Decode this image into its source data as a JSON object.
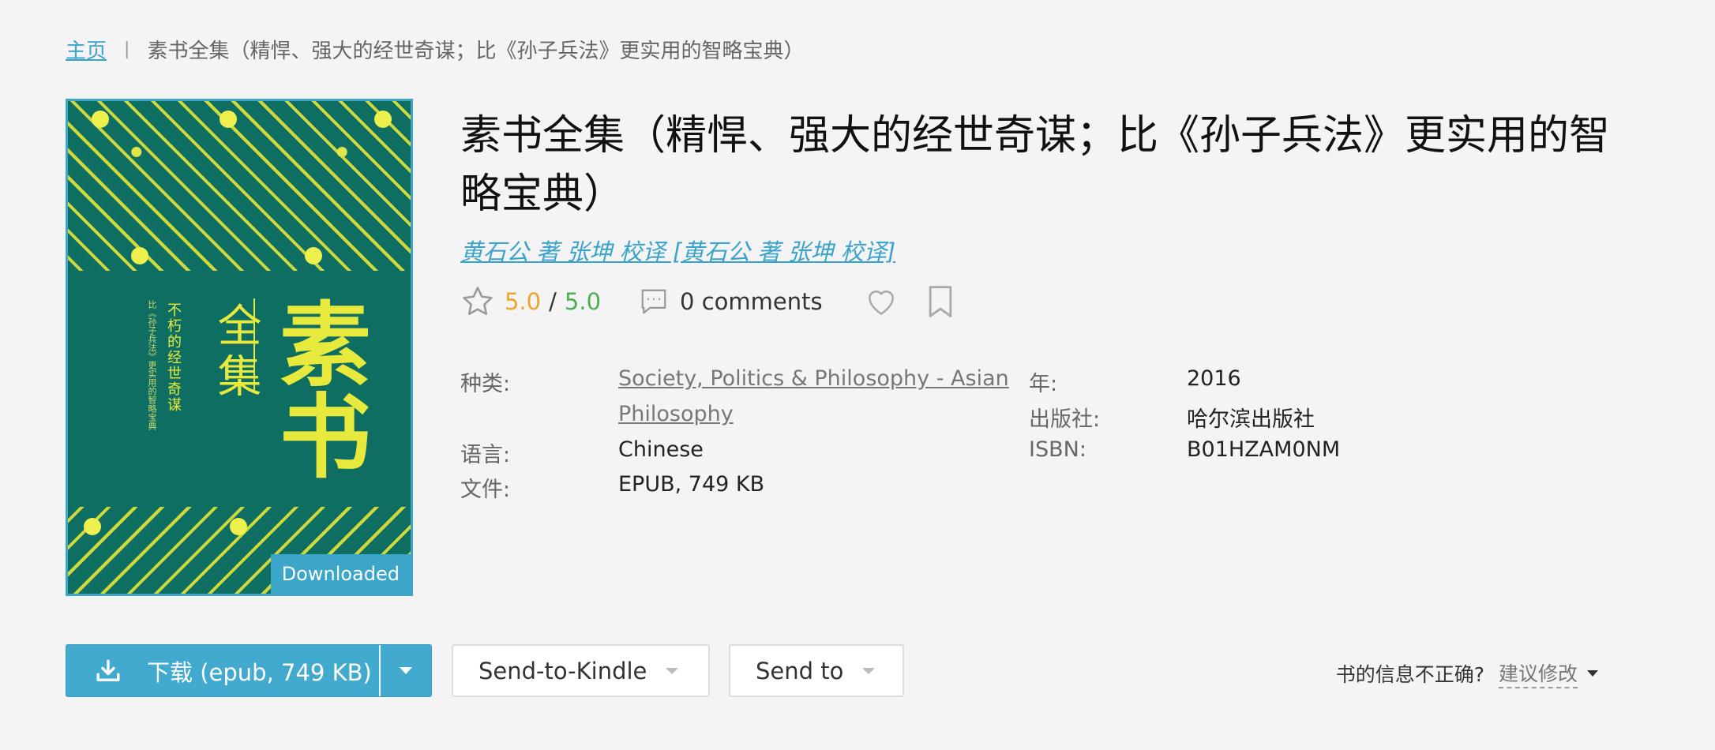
{
  "breadcrumb": {
    "home": "主页",
    "separator": "|",
    "current": "素书全集（精悍、强大的经世奇谋；比《孙子兵法》更实用的智略宝典）"
  },
  "cover": {
    "badge": "Downloaded",
    "title_big": "素书",
    "title_small": "全集",
    "tagline": "不朽的经世奇谋",
    "subline": "比《孙子兵法》更实用的智略宝典",
    "colors": {
      "background": "#0f6e62",
      "ornament": "#e7ea3c",
      "border": "#3ba6c9"
    }
  },
  "book": {
    "title": "素书全集（精悍、强大的经世奇谋；比《孙子兵法》更实用的智略宝典）",
    "authors": "黄石公 著 张坤 校译 [黄石公 著 张坤 校译]"
  },
  "rating": {
    "icon": "star-outline-icon",
    "score_a": "5.0",
    "slash": "/",
    "score_b": "5.0",
    "comments": "0 comments",
    "colors": {
      "score_a": "#f0a22e",
      "score_b": "#4caf50"
    }
  },
  "details": {
    "category_label": "种类:",
    "category_value_line1": "Society, Politics & Philosophy - Asian",
    "category_value_line2": "Philosophy",
    "language_label": "语言:",
    "language_value": "Chinese",
    "file_label": "文件:",
    "file_value": "EPUB, 749 KB",
    "year_label": "年:",
    "year_value": "2016",
    "publisher_label": "出版社:",
    "publisher_value": "哈尔滨出版社",
    "isbn_label": "ISBN:",
    "isbn_value": "B01HZAM0NM"
  },
  "actions": {
    "download_label": "下载 (epub, 749 KB)",
    "kindle_label": "Send-to-Kindle",
    "sendto_label": "Send to",
    "accent_color": "#42a9cf"
  },
  "report": {
    "question": "书的信息不正确?",
    "suggest": "建议修改"
  }
}
